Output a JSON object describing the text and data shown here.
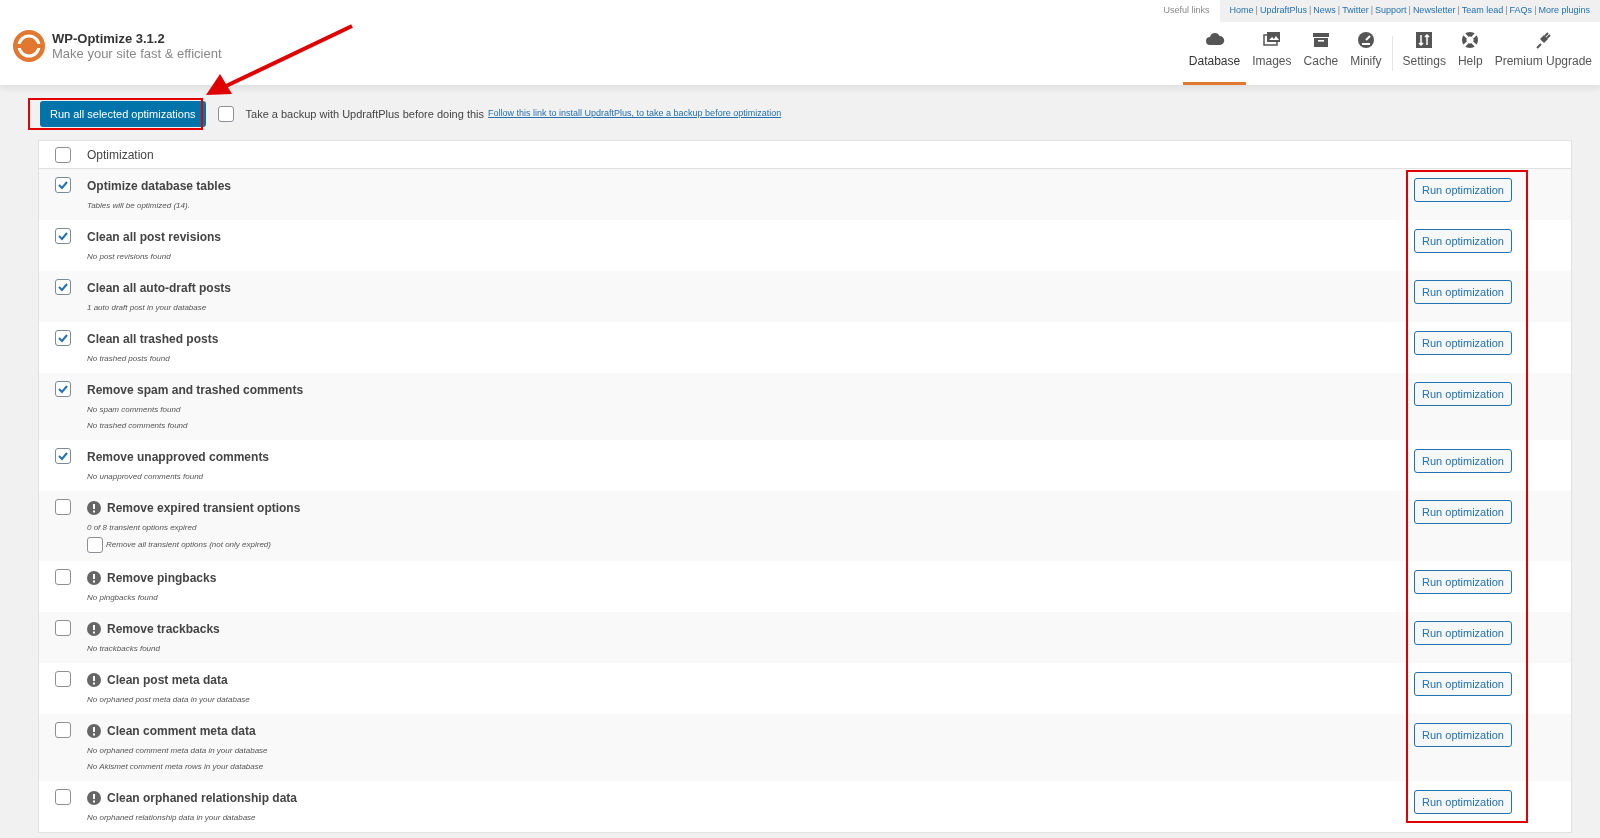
{
  "header": {
    "title": "WP-Optimize 3.1.2",
    "tagline": "Make your site fast & efficient",
    "useful_links_label": "Useful links",
    "link_separator": "|",
    "useful_links": [
      "Home",
      "UpdraftPlus",
      "News",
      "Twitter",
      "Support",
      "Newsletter",
      "Team lead",
      "FAQs",
      "More plugins"
    ],
    "tabs": [
      {
        "label": "Database",
        "selected": true
      },
      {
        "label": "Images",
        "selected": false
      },
      {
        "label": "Cache",
        "selected": false
      },
      {
        "label": "Minify",
        "selected": false
      },
      {
        "label": "Settings",
        "selected": false
      },
      {
        "label": "Help",
        "selected": false
      },
      {
        "label": "Premium Upgrade",
        "selected": false
      }
    ]
  },
  "toolbar": {
    "run_all_button": "Run all selected optimizations",
    "backup_checked": false,
    "backup_label": "Take a backup with UpdraftPlus before doing this",
    "backup_link": "Follow this link to install UpdraftPlus, to take a backup before optimization"
  },
  "table": {
    "header_checked": false,
    "header_label": "Optimization",
    "rows": [
      {
        "title": "Optimize database tables",
        "warning": false,
        "checked": true,
        "button": "Run optimization",
        "details": [
          {
            "kind": "note",
            "text": "Tables will be optimized (14)."
          }
        ]
      },
      {
        "title": "Clean all post revisions",
        "warning": false,
        "checked": true,
        "button": "Run optimization",
        "details": [
          {
            "kind": "note",
            "text": "No post revisions found"
          }
        ]
      },
      {
        "title": "Clean all auto-draft posts",
        "warning": false,
        "checked": true,
        "button": "Run optimization",
        "details": [
          {
            "kind": "note",
            "text": "1 auto draft post in your database"
          }
        ]
      },
      {
        "title": "Clean all trashed posts",
        "warning": false,
        "checked": true,
        "button": "Run optimization",
        "details": [
          {
            "kind": "note",
            "text": "No trashed posts found"
          }
        ]
      },
      {
        "title": "Remove spam and trashed comments",
        "warning": false,
        "checked": true,
        "button": "Run optimization",
        "details": [
          {
            "kind": "note",
            "text": "No spam comments found"
          },
          {
            "kind": "note",
            "text": "No trashed comments found"
          }
        ]
      },
      {
        "title": "Remove unapproved comments",
        "warning": false,
        "checked": true,
        "button": "Run optimization",
        "details": [
          {
            "kind": "note",
            "text": "No unapproved comments found"
          }
        ]
      },
      {
        "title": "Remove expired transient options",
        "warning": true,
        "checked": false,
        "button": "Run optimization",
        "details": [
          {
            "kind": "note",
            "text": "0 of 8 transient options expired"
          },
          {
            "kind": "checkbox",
            "text": "Remove all transient options (not only expired)",
            "checked": false
          }
        ]
      },
      {
        "title": "Remove pingbacks",
        "warning": true,
        "checked": false,
        "button": "Run optimization",
        "details": [
          {
            "kind": "note",
            "text": "No pingbacks found"
          }
        ]
      },
      {
        "title": "Remove trackbacks",
        "warning": true,
        "checked": false,
        "button": "Run optimization",
        "details": [
          {
            "kind": "note",
            "text": "No trackbacks found"
          }
        ]
      },
      {
        "title": "Clean post meta data",
        "warning": true,
        "checked": false,
        "button": "Run optimization",
        "details": [
          {
            "kind": "note",
            "text": "No orphaned post meta data in your database"
          }
        ]
      },
      {
        "title": "Clean comment meta data",
        "warning": true,
        "checked": false,
        "button": "Run optimization",
        "details": [
          {
            "kind": "note",
            "text": "No orphaned comment meta data in your database"
          },
          {
            "kind": "note",
            "text": "No Akismet comment meta rows in your database"
          }
        ]
      },
      {
        "title": "Clean orphaned relationship data",
        "warning": true,
        "checked": false,
        "button": "Run optimization",
        "details": [
          {
            "kind": "note",
            "text": "No orphaned relationship data in your database"
          }
        ]
      }
    ]
  }
}
